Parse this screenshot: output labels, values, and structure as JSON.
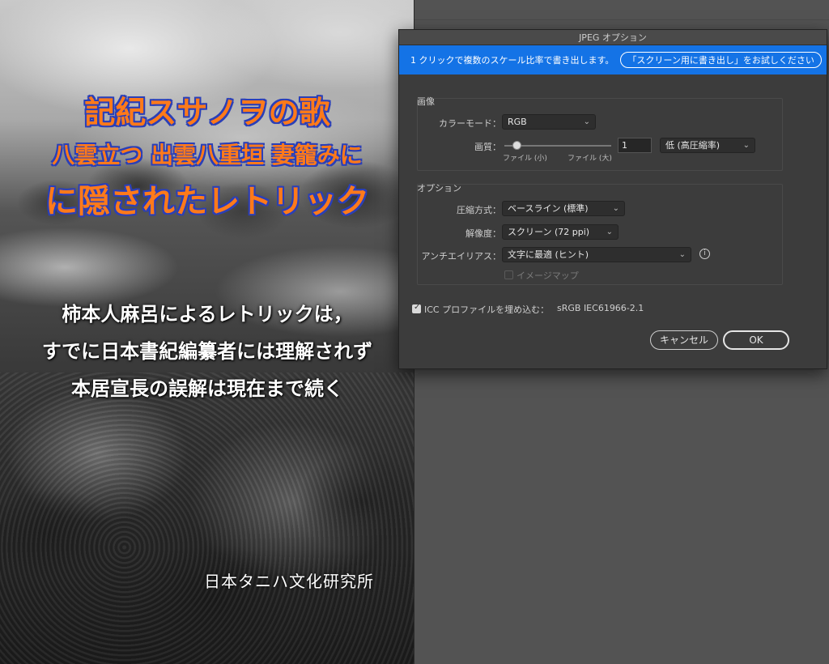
{
  "cover": {
    "title_line1": "記紀スサノヲの歌",
    "title_line2": "八雲立つ 出雲八重垣 妻籠みに",
    "title_line3": "に隠されたレトリック",
    "sub_line1": "柿本人麻呂によるレトリックは，",
    "sub_line2": "すでに日本書紀編纂者には理解されず",
    "sub_line3": "本居宣長の誤解は現在まで続く",
    "organization": "日本タニハ文化研究所",
    "title_color": "#ff7a1a",
    "title_outline": "#2a3fb8"
  },
  "dialog": {
    "title": "JPEG オプション",
    "info_text": "1 クリックで複数のスケール比率で書き出します。",
    "info_link": "「スクリーン用に書き出し」をお試しください",
    "image_section": {
      "title": "画像",
      "color_mode_label": "カラーモード：",
      "color_mode_value": "RGB",
      "quality_label": "画質：",
      "quality_value": "1",
      "quality_min_label": "ファイル (小)",
      "quality_max_label": "ファイル (大)",
      "quality_preset": "低 (高圧縮率)"
    },
    "options_section": {
      "title": "オプション",
      "compression_label": "圧縮方式：",
      "compression_value": "ベースライン (標準)",
      "resolution_label": "解像度：",
      "resolution_value": "スクリーン (72 ppi)",
      "antialias_label": "アンチエイリアス：",
      "antialias_value": "文字に最適 (ヒント)",
      "imagemap_label": "イメージマップ"
    },
    "icc_label": "ICC プロファイルを埋め込む：",
    "icc_value": "sRGB IEC61966-2.1",
    "cancel_label": "キャンセル",
    "ok_label": "OK",
    "accent_color": "#1473e6"
  }
}
